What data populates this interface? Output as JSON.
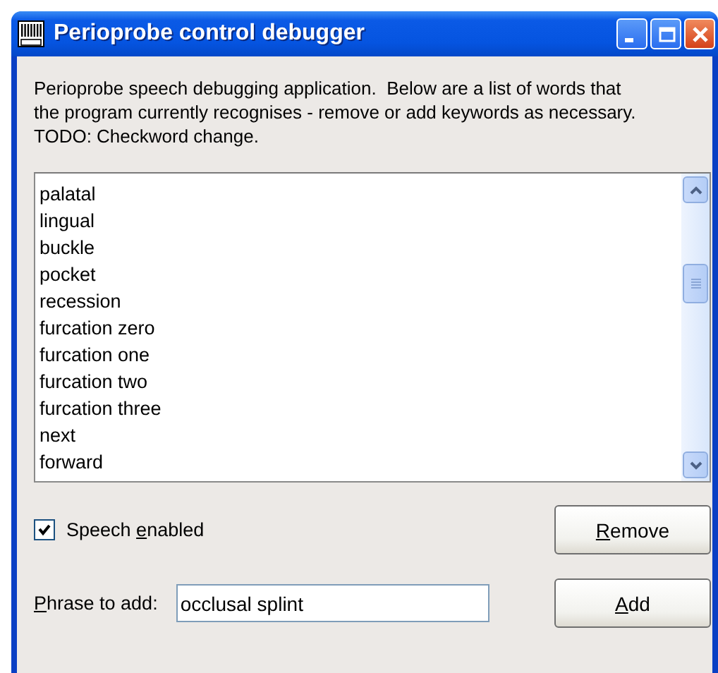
{
  "window": {
    "title": "Perioprobe control debugger"
  },
  "description": "Perioprobe speech debugging application.  Below are a list of words that the program currently recognises - remove or add keywords as necessary. TODO: Checkword change.",
  "keywords": [
    {
      "text": "palatal"
    },
    {
      "text": "lingual"
    },
    {
      "text": "buckle"
    },
    {
      "text": "pocket"
    },
    {
      "text": "recession"
    },
    {
      "text": "furcation zero"
    },
    {
      "text": "furcation one"
    },
    {
      "text": "furcation two"
    },
    {
      "text": "furcation three"
    },
    {
      "text": "next"
    },
    {
      "text": "forward"
    }
  ],
  "speech_enabled": {
    "label": {
      "before": "Speech ",
      "key": "e",
      "after": "nabled"
    },
    "checked": true
  },
  "remove_button": {
    "label": {
      "key": "R",
      "after": "emove"
    }
  },
  "phrase": {
    "label": {
      "key": "P",
      "after": "hrase to add:"
    },
    "value": "occlusal splint"
  },
  "add_button": {
    "label": {
      "key": "A",
      "after": "dd"
    }
  }
}
